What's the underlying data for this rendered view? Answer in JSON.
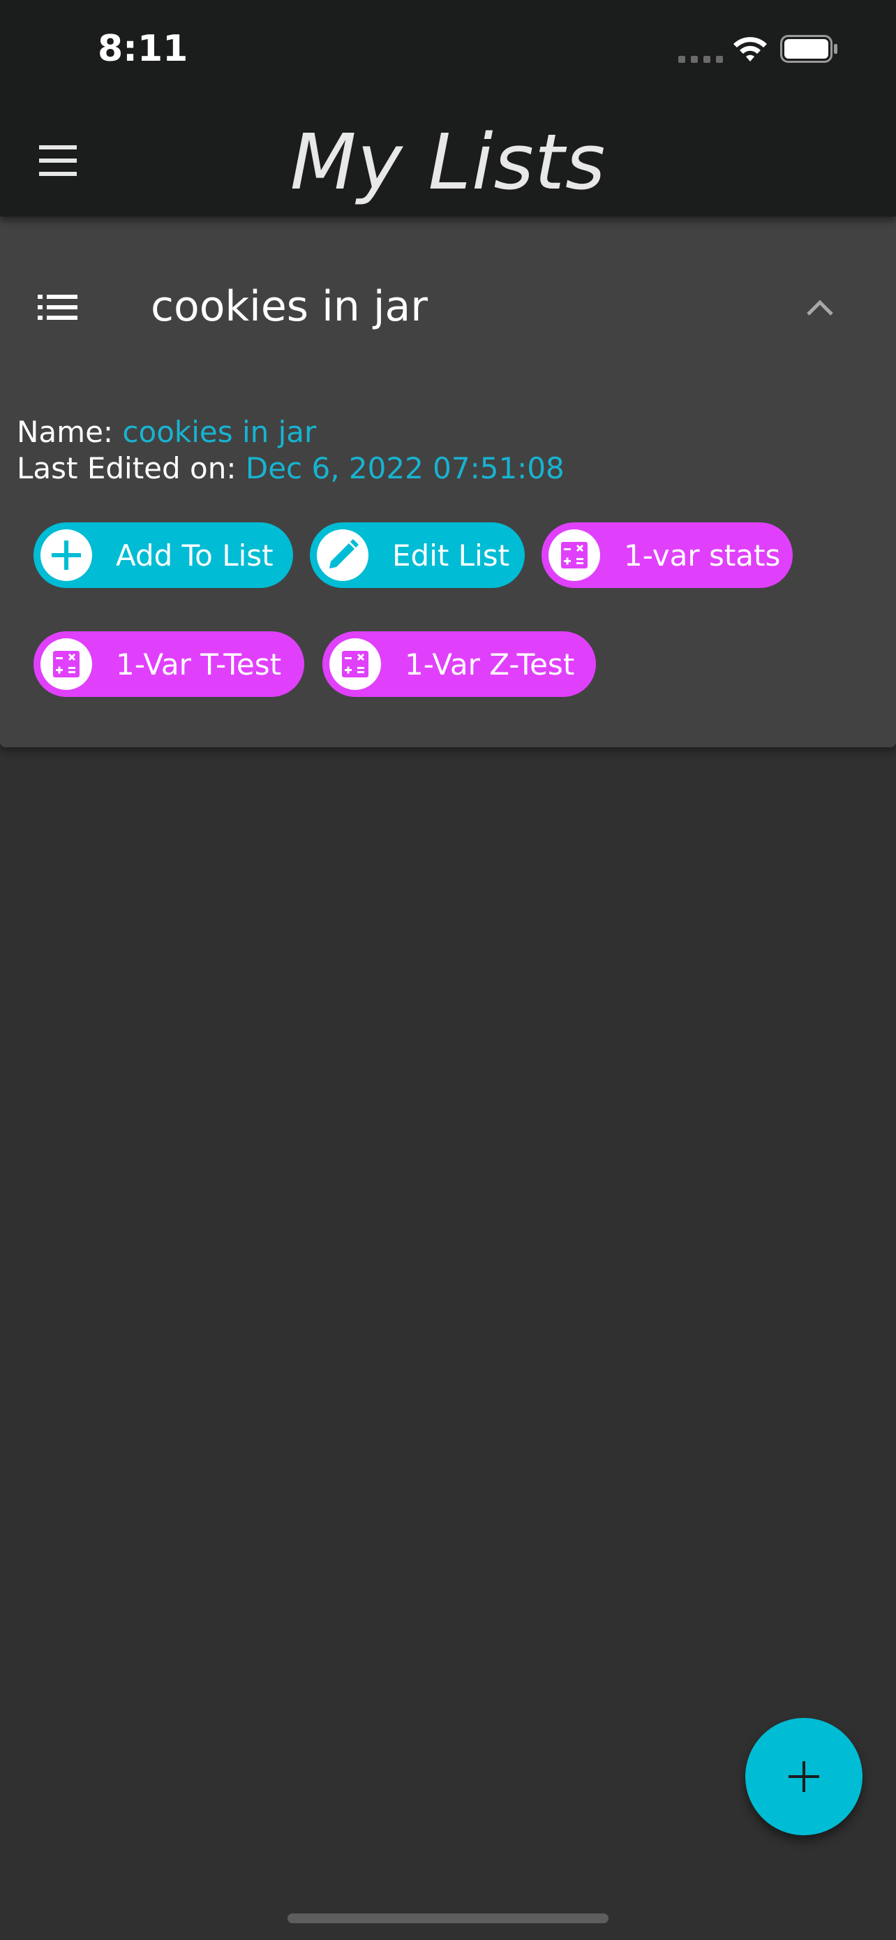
{
  "status_bar": {
    "time": "8:11"
  },
  "app_bar": {
    "title": "My Lists"
  },
  "list_card": {
    "title": "cookies in jar",
    "name_label": "Name:",
    "name_value": "cookies in jar",
    "edited_label": "Last Edited on:",
    "edited_value": "Dec 6, 2022 07:51:08",
    "actions": [
      {
        "label": "Add To List",
        "icon": "add-circle-icon",
        "color": "#00bcd4"
      },
      {
        "label": "Edit List",
        "icon": "pencil-icon",
        "color": "#00bcd4"
      },
      {
        "label": "1-var stats",
        "icon": "calculator-icon",
        "color": "#e040fb"
      },
      {
        "label": "1-Var T-Test",
        "icon": "calculator-icon",
        "color": "#e040fb"
      },
      {
        "label": "1-Var Z-Test",
        "icon": "calculator-icon",
        "color": "#e040fb"
      }
    ]
  },
  "fab": {
    "icon": "plus-icon",
    "color": "#00bcd4"
  },
  "colors": {
    "background": "#303030",
    "card": "#424242",
    "app_bar": "#1b1c1c",
    "accent_text": "#17b4d1"
  }
}
